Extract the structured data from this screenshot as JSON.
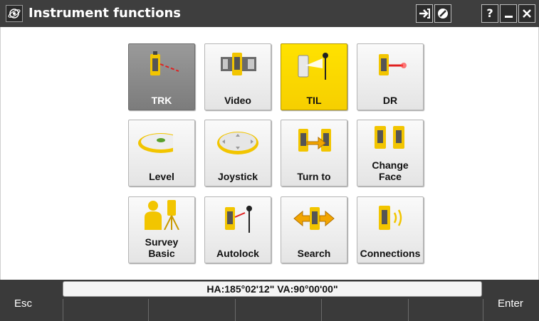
{
  "title_bar": {
    "title": "Instrument functions",
    "logo_icon": "trimble-access-logo-icon",
    "buttons": [
      "login-icon",
      "disable-icon",
      "help-icon",
      "minimize-icon",
      "close-icon"
    ],
    "help_label": "?",
    "minimize_label": "—",
    "close_label": "✕"
  },
  "tiles": [
    {
      "label": "TRK",
      "icon": "tracking-laser-icon",
      "state": "pressed"
    },
    {
      "label": "Video",
      "icon": "video-icon",
      "state": "normal"
    },
    {
      "label": "TIL",
      "icon": "target-illumination-icon",
      "state": "active"
    },
    {
      "label": "DR",
      "icon": "direct-reflex-icon",
      "state": "normal"
    },
    {
      "label": "Level",
      "icon": "level-bubble-icon",
      "state": "normal"
    },
    {
      "label": "Joystick",
      "icon": "joystick-icon",
      "state": "normal"
    },
    {
      "label": "Turn to",
      "icon": "turn-to-icon",
      "state": "normal"
    },
    {
      "label": "Change\nFace",
      "icon": "change-face-icon",
      "state": "normal"
    },
    {
      "label": "Survey\nBasic",
      "icon": "survey-basic-icon",
      "state": "normal"
    },
    {
      "label": "Autolock",
      "icon": "autolock-icon",
      "state": "normal"
    },
    {
      "label": "Search",
      "icon": "search-prism-icon",
      "state": "normal"
    },
    {
      "label": "Connections",
      "icon": "connections-icon",
      "state": "normal"
    }
  ],
  "status_bar": {
    "text": "HA:185°02'12\"  VA:90°00'00\""
  },
  "softkeys": {
    "esc": "Esc",
    "enter": "Enter"
  },
  "colors": {
    "title_bar": "#3e3e3e",
    "active_tile": "#ffdd00",
    "pressed_tile": "#888888",
    "bottom_bar": "#3a3a3a",
    "instrument_yellow": "#f2c500"
  }
}
